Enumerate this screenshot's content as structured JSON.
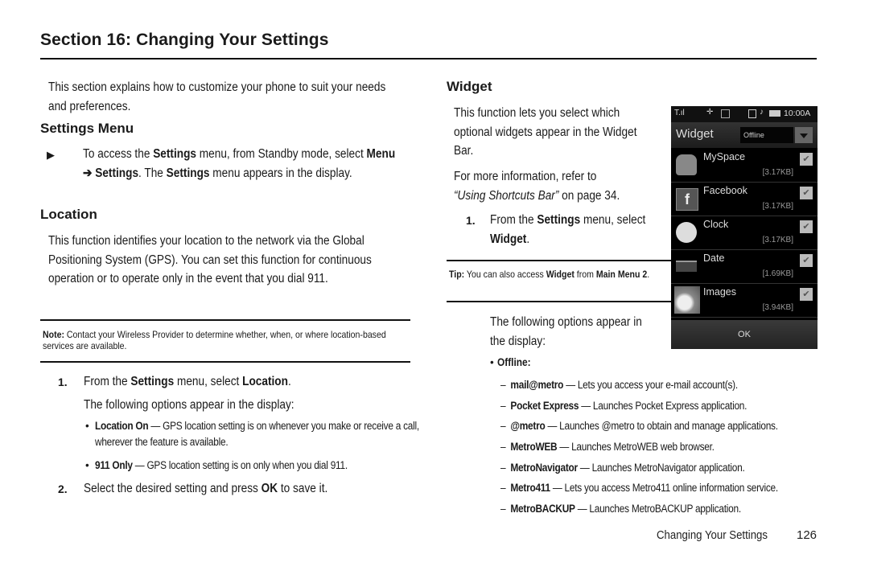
{
  "header": {
    "title": "Section 16: Changing Your Settings"
  },
  "left": {
    "intro": "This section explains how to customize your phone to suit your needs and preferences.",
    "settings_menu": {
      "heading": "Settings Menu",
      "bullet_glyph": "▶",
      "text_1": "To access the ",
      "bold_1": "Settings",
      "text_2": " menu, from Standby mode, select ",
      "bold_2": "Menu ➔ Settings",
      "text_3": ". The ",
      "bold_3": "Settings",
      "text_4": " menu appears in the display."
    },
    "location": {
      "heading": "Location",
      "description": "This function identifies your location to the network via the Global Positioning System (GPS). You can set this function for continuous operation or to operate only in the event that you dial 911.",
      "note_label": "Note:",
      "note_text": "Contact your Wireless Provider to determine whether, when, or where location-based services are available.",
      "step1_num": "1.",
      "step1_text_a": "From the ",
      "step1_bold_a": "Settings",
      "step1_text_b": " menu, select ",
      "step1_bold_b": "Location",
      "step1_text_c": ".",
      "options_intro": "The following options appear in the display:",
      "options": [
        {
          "name": "Location On",
          "desc": " — GPS location setting is on whenever you make or receive a call, wherever the feature is available."
        },
        {
          "name": "911 Only",
          "desc": " — GPS location setting is on only when you dial 911."
        }
      ],
      "step2_num": "2.",
      "step2_text_a": "Select the desired setting and press ",
      "step2_bold": "OK",
      "step2_text_b": " to save it."
    }
  },
  "right": {
    "widget": {
      "heading": "Widget",
      "description": "This function lets you select which optional widgets appear in the Widget Bar.",
      "more_info": "For more information, refer to ",
      "ref_link": "“Using Shortcuts Bar”",
      "ref_page": " on page 34.",
      "step1_num": "1.",
      "step1_text_a": "From the ",
      "step1_bold_a": "Settings",
      "step1_text_b": " menu, select ",
      "step1_bold_b": "Widget",
      "step1_text_c": ".",
      "tip_label": "Tip:",
      "tip_text_a": "You can also access ",
      "tip_bold_a": "Widget",
      "tip_text_b": " from ",
      "tip_bold_b": "Main Menu 2",
      "tip_text_c": ".",
      "options_intro": "The following options appear in the display:",
      "offline_label": "Offline:",
      "offline_items": [
        {
          "name": "mail@metro",
          "desc": " — Lets you access your e-mail account(s)."
        },
        {
          "name": "Pocket Express",
          "desc": " — Launches Pocket Express application."
        },
        {
          "name": "@metro",
          "desc": " — Launches @metro to obtain and manage applications."
        },
        {
          "name": "MetroWEB",
          "desc": " — Launches MetroWEB web browser."
        },
        {
          "name": "MetroNavigator",
          "desc": " — Launches MetroNavigator application."
        },
        {
          "name": "Metro411",
          "desc": " — Lets you access Metro411 online information service."
        },
        {
          "name": "MetroBACKUP",
          "desc": " — Launches MetroBACKUP application."
        }
      ]
    },
    "phone": {
      "status_time": "10:00A",
      "title": "Widget",
      "dropdown_value": "Offline",
      "rows": [
        {
          "name": "MySpace",
          "size": "[3.17KB]",
          "icon": "myspace-icon",
          "checked": true
        },
        {
          "name": "Facebook",
          "size": "[3.17KB]",
          "icon": "facebook-icon",
          "checked": true
        },
        {
          "name": "Clock",
          "size": "[3.17KB]",
          "icon": "clock-icon",
          "checked": true
        },
        {
          "name": "Date",
          "size": "[1.69KB]",
          "icon": "date-icon",
          "checked": true
        },
        {
          "name": "Images",
          "size": "[3.94KB]",
          "icon": "images-icon",
          "checked": true
        }
      ],
      "check_glyph": "✔",
      "ok_label": "OK"
    }
  },
  "footer": {
    "section_name": "Changing Your Settings",
    "page_number": "126"
  }
}
